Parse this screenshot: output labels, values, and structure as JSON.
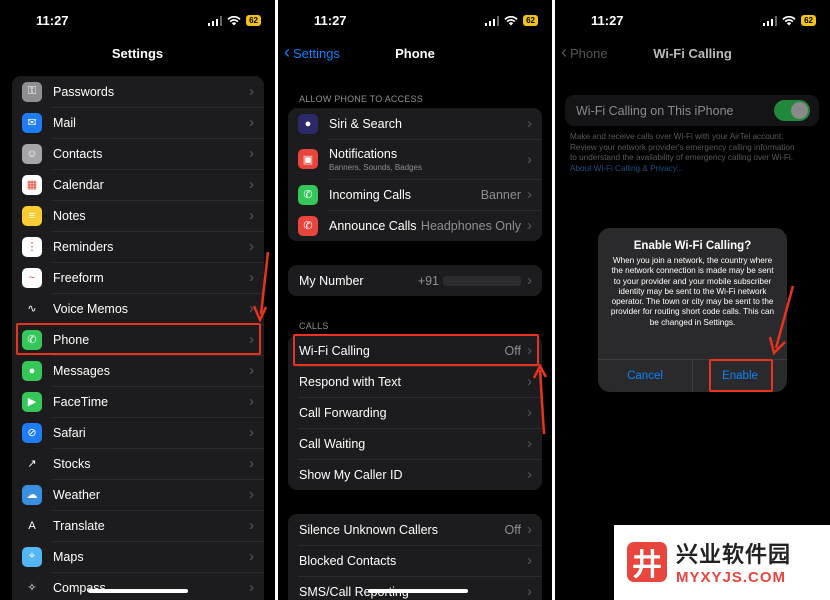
{
  "status": {
    "time": "11:27",
    "battery": "62"
  },
  "panel1": {
    "title": "Settings",
    "items": [
      {
        "label": "Passwords",
        "icon": "key-icon",
        "color": "#8e8e93"
      },
      {
        "label": "Mail",
        "icon": "mail-icon",
        "color": "#1f7cf5"
      },
      {
        "label": "Contacts",
        "icon": "contacts-icon",
        "color": "#a6a6aa"
      },
      {
        "label": "Calendar",
        "icon": "calendar-icon",
        "color": "#ffffff"
      },
      {
        "label": "Notes",
        "icon": "notes-icon",
        "color": "#f7cc34"
      },
      {
        "label": "Reminders",
        "icon": "reminders-icon",
        "color": "#ffffff"
      },
      {
        "label": "Freeform",
        "icon": "freeform-icon",
        "color": "#ffffff"
      },
      {
        "label": "Voice Memos",
        "icon": "voice-memos-icon",
        "color": "#1c1c1e"
      },
      {
        "label": "Phone",
        "icon": "phone-icon",
        "color": "#35c759"
      },
      {
        "label": "Messages",
        "icon": "messages-icon",
        "color": "#35c759"
      },
      {
        "label": "FaceTime",
        "icon": "facetime-icon",
        "color": "#35c759"
      },
      {
        "label": "Safari",
        "icon": "safari-icon",
        "color": "#1f7cf5"
      },
      {
        "label": "Stocks",
        "icon": "stocks-icon",
        "color": "#1c1c1e"
      },
      {
        "label": "Weather",
        "icon": "weather-icon",
        "color": "#3a8fe0"
      },
      {
        "label": "Translate",
        "icon": "translate-icon",
        "color": "#1c1c1e"
      },
      {
        "label": "Maps",
        "icon": "maps-icon",
        "color": "#55b6f5"
      },
      {
        "label": "Compass",
        "icon": "compass-icon",
        "color": "#1c1c1e"
      }
    ]
  },
  "panel2": {
    "back": "Settings",
    "title": "Phone",
    "section1": "ALLOW PHONE TO ACCESS",
    "access": [
      {
        "label": "Siri & Search",
        "value": "",
        "icon": "siri-icon",
        "color": "#2a2a6a"
      },
      {
        "label": "Notifications",
        "sub": "Banners, Sounds, Badges",
        "value": "",
        "icon": "notifications-icon",
        "color": "#e8453c"
      },
      {
        "label": "Incoming Calls",
        "value": "Banner",
        "icon": "incoming-calls-icon",
        "color": "#35c759"
      },
      {
        "label": "Announce Calls",
        "value": "Headphones Only",
        "icon": "announce-calls-icon",
        "color": "#e8453c"
      }
    ],
    "my_number": {
      "label": "My Number",
      "value": "+91"
    },
    "section2": "CALLS",
    "calls": [
      {
        "label": "Wi-Fi Calling",
        "value": "Off"
      },
      {
        "label": "Respond with Text",
        "value": ""
      },
      {
        "label": "Call Forwarding",
        "value": ""
      },
      {
        "label": "Call Waiting",
        "value": ""
      },
      {
        "label": "Show My Caller ID",
        "value": ""
      }
    ],
    "more": [
      {
        "label": "Silence Unknown Callers",
        "value": "Off"
      },
      {
        "label": "Blocked Contacts",
        "value": ""
      },
      {
        "label": "SMS/Call Reporting",
        "value": ""
      }
    ]
  },
  "panel3": {
    "back": "Phone",
    "title": "Wi-Fi Calling",
    "toggle_label": "Wi-Fi Calling on This iPhone",
    "footer": "Make and receive calls over Wi-Fi with your AirTel account. Review your network provider's emergency calling information to understand the availability of emergency calling over Wi-Fi.",
    "footer_link": "About Wi-Fi Calling & Privacy...",
    "dialog": {
      "title": "Enable Wi-Fi Calling?",
      "body": "When you join a network, the country where the network connection is made may be sent to your provider and your mobile subscriber identity may be sent to the Wi-Fi network operator. The town or city may be sent to the provider for routing short code calls. This can be changed in Settings.",
      "cancel": "Cancel",
      "enable": "Enable"
    }
  },
  "watermark": {
    "cn": "兴业软件园",
    "en": "MYXYJS.COM",
    "logo": "井"
  },
  "colors": {
    "accent": "#0a84ff",
    "highlight": "#e8331e"
  }
}
